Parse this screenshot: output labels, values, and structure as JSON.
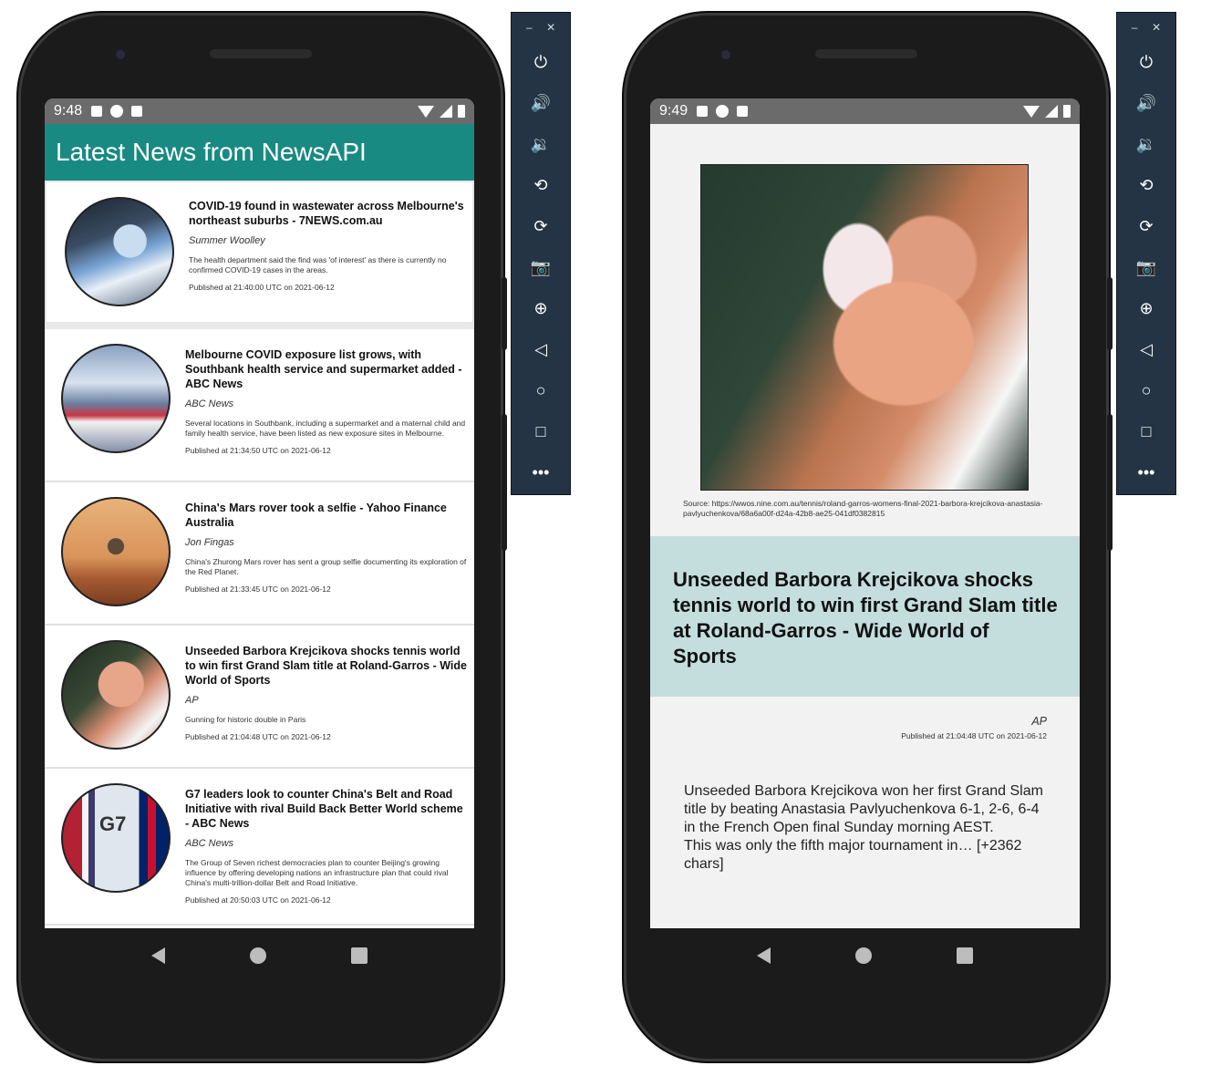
{
  "toolbar": {
    "minimize": "–",
    "close": "✕",
    "buttons": [
      {
        "icon": "power-icon",
        "glyph": "⏻"
      },
      {
        "icon": "volume-up-icon",
        "glyph": "🔊"
      },
      {
        "icon": "volume-down-icon",
        "glyph": "🔉"
      },
      {
        "icon": "rotate-left-icon",
        "glyph": "⟲"
      },
      {
        "icon": "rotate-right-icon",
        "glyph": "⟳"
      },
      {
        "icon": "camera-icon",
        "glyph": "📷"
      },
      {
        "icon": "zoom-icon",
        "glyph": "⊕"
      },
      {
        "icon": "back-icon",
        "glyph": "◁"
      },
      {
        "icon": "home-icon",
        "glyph": "○"
      },
      {
        "icon": "overview-icon",
        "glyph": "□"
      },
      {
        "icon": "more-icon",
        "glyph": "•••"
      }
    ]
  },
  "phone1": {
    "time": "9:48",
    "app_title": "Latest News from NewsAPI",
    "articles": [
      {
        "title": "COVID-19 found in wastewater across Melbourne's northeast suburbs - 7NEWS.com.au",
        "author": "Summer Woolley",
        "description": "The health department said the find was 'of interest' as there is currently no confirmed COVID-19 cases in the areas.",
        "published": "Published at 21:40:00 UTC on 2021-06-12"
      },
      {
        "title": "Melbourne COVID exposure list grows, with Southbank health service and supermarket added - ABC News",
        "author": "ABC News",
        "description": "Several locations in Southbank, including a supermarket and a maternal child and family health service, have been listed as new exposure sites in Melbourne.",
        "published": "Published at 21:34:50 UTC on 2021-06-12"
      },
      {
        "title": "China's Mars rover took a selfie - Yahoo Finance Australia",
        "author": "Jon Fingas",
        "description": "China's Zhurong Mars rover has sent a group selfie documenting its exploration of the Red Planet.",
        "published": "Published at 21:33:45 UTC on 2021-06-12"
      },
      {
        "title": "Unseeded Barbora Krejcikova shocks tennis world to win first Grand Slam title at Roland-Garros - Wide World of Sports",
        "author": "AP",
        "description": "Gunning for historic double in Paris",
        "published": "Published at 21:04:48 UTC on 2021-06-12"
      },
      {
        "title": "G7 leaders look to counter China's Belt and Road Initiative with rival Build Back Better World scheme - ABC News",
        "author": "ABC News",
        "description": "The Group of Seven richest democracies plan to counter Beijing's growing influence by offering developing nations an infrastructure plan that could rival China's multi-trillion-dollar Belt and Road Initiative.",
        "published": "Published at 20:50:03 UTC on 2021-06-12",
        "thumb_text": "G7"
      }
    ]
  },
  "phone2": {
    "time": "9:49",
    "source": "Source: https://wwos.nine.com.au/tennis/roland-garros-womens-final-2021-barbora-krejcikova-anastasia-pavlyuchenkova/68a6a00f-d24a-42b8-ae25-041df0382815",
    "title": "Unseeded Barbora Krejcikova shocks tennis world to win first Grand Slam title at Roland-Garros - Wide World of Sports",
    "author": "AP",
    "published": "Published at 21:04:48 UTC on 2021-06-12",
    "content": "Unseeded Barbora Krejcikova won her first Grand Slam title by beating Anastasia Pavlyuchenkova 6-1, 2-6, 6-4 in the French Open final Sunday morning AEST.\nThis was only the fifth major tournament in… [+2362 chars]"
  },
  "colors": {
    "app_bar": "#188a82",
    "status_bar": "#6b6b6b",
    "title_box": "#c4dede",
    "toolbar": "#243444"
  }
}
